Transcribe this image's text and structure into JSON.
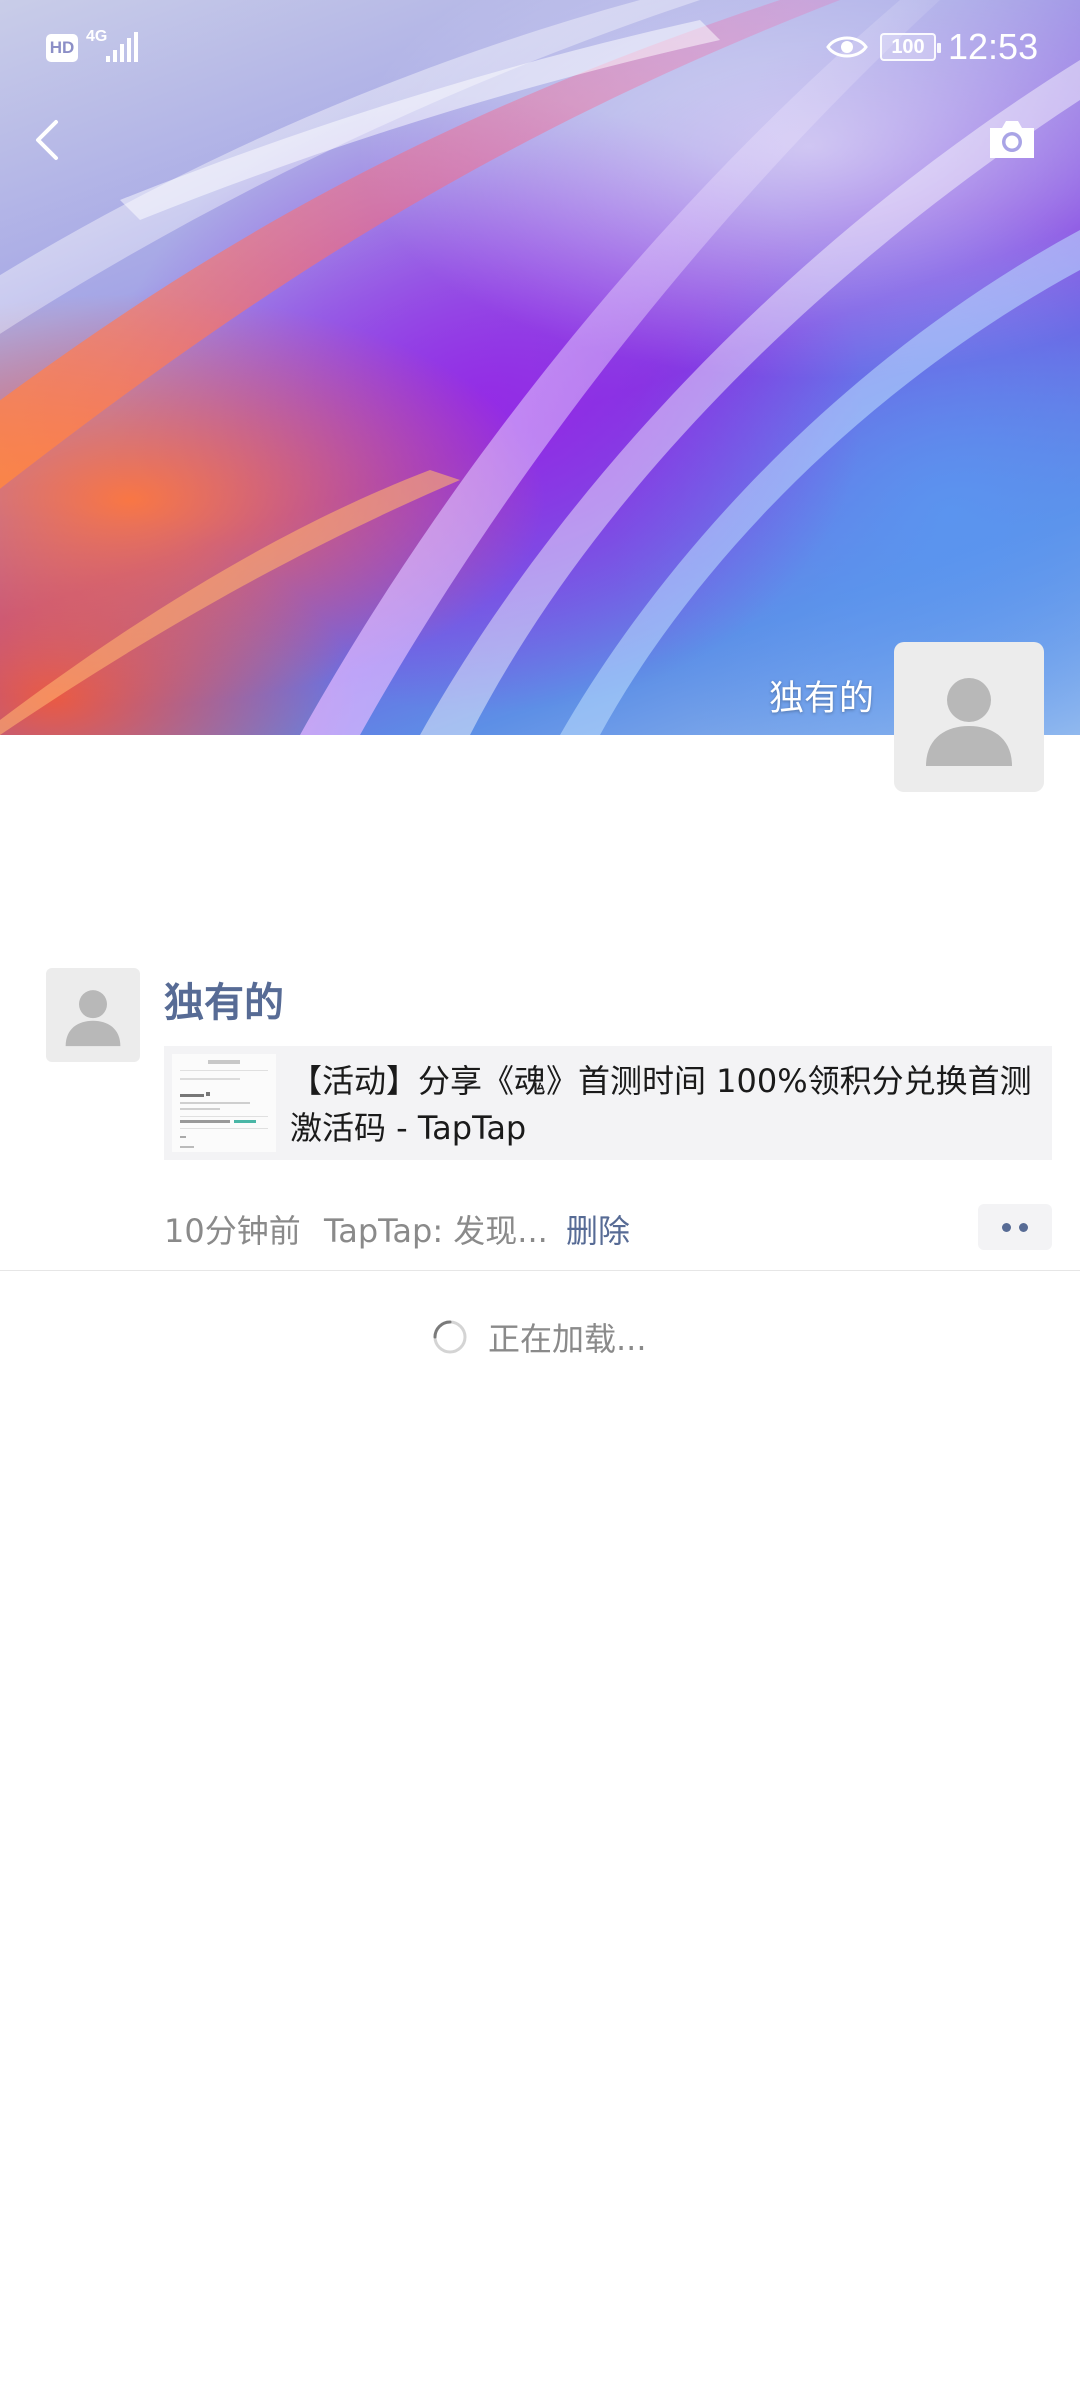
{
  "status_bar": {
    "hd_badge": "HD",
    "network": "4G",
    "battery": "100",
    "time": "12:53",
    "icons": [
      "hd-icon",
      "signal-icon",
      "eye-icon",
      "battery-icon"
    ]
  },
  "header": {
    "back_icon": "chevron-left-icon",
    "camera_icon": "camera-icon"
  },
  "profile": {
    "name": "独有的",
    "avatar_icon": "default-avatar-icon"
  },
  "post": {
    "author": "独有的",
    "link_title": "【活动】分享《魂》首测时间 100%领积分兑换首测激活码 - TapTap",
    "time": "10分钟前",
    "source": "TapTap: 发现...",
    "delete_label": "删除",
    "more_icon": "more-dots-icon"
  },
  "loading": {
    "text": "正在加载..."
  },
  "colors": {
    "link_blue": "#576b95",
    "meta_gray": "#8a8a8a",
    "card_bg": "#f3f3f5"
  }
}
